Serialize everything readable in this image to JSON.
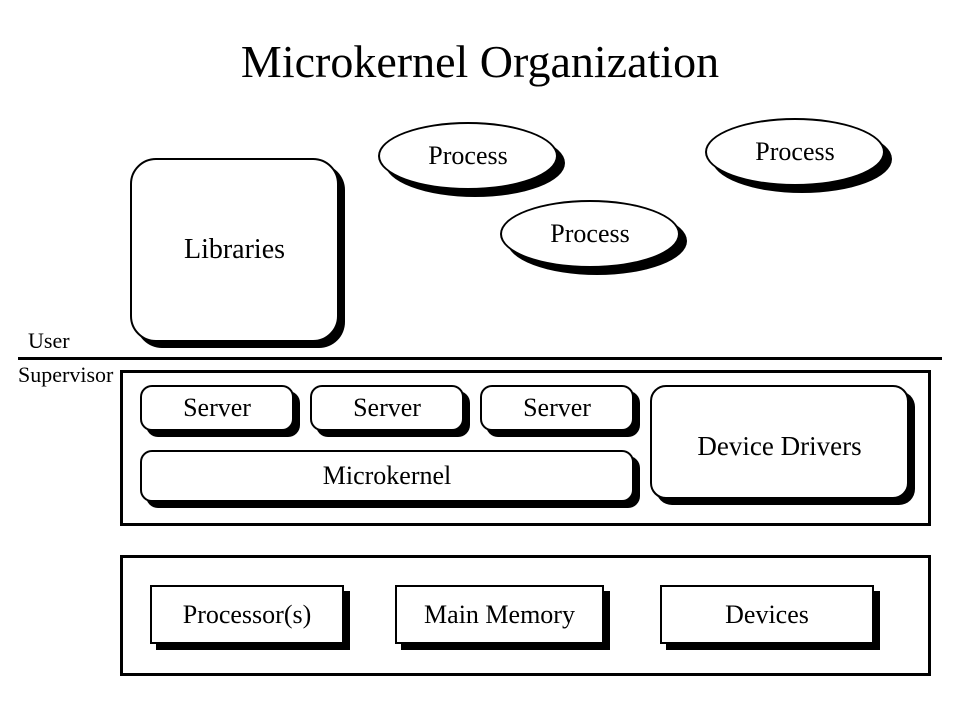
{
  "title": "Microkernel Organization",
  "labels": {
    "user": "User",
    "supervisor": "Supervisor"
  },
  "libraries": "Libraries",
  "processes": [
    "Process",
    "Process",
    "Process"
  ],
  "supervisor": {
    "servers": [
      "Server",
      "Server",
      "Server"
    ],
    "device_drivers": "Device Drivers",
    "microkernel": "Microkernel"
  },
  "hardware": {
    "processor": "Processor(s)",
    "memory": "Main Memory",
    "devices": "Devices"
  }
}
